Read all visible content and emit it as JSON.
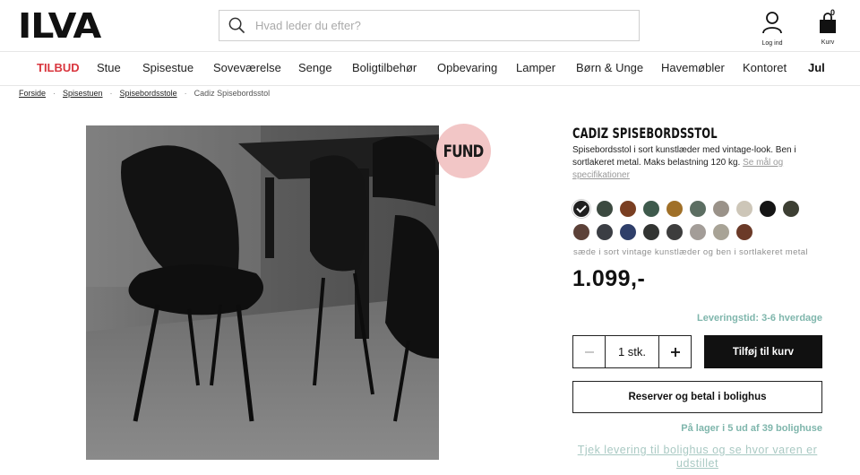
{
  "brand": {
    "logo_text": "ILVA"
  },
  "search": {
    "placeholder": "Hvad leder du efter?",
    "icon": "search-icon"
  },
  "account": {
    "label": "Log ind",
    "icon": "user-icon"
  },
  "cart": {
    "label": "Kurv",
    "count": "0",
    "icon": "bag-icon"
  },
  "nav": {
    "items": [
      {
        "label": "TILBUD",
        "style": "sale"
      },
      {
        "label": "Stue"
      },
      {
        "label": "Spisestue"
      },
      {
        "label": "Soveværelse"
      },
      {
        "label": "Senge"
      },
      {
        "label": "Boligtilbehør"
      },
      {
        "label": "Opbevaring"
      },
      {
        "label": "Lamper"
      },
      {
        "label": "Børn & Unge"
      },
      {
        "label": "Havemøbler"
      },
      {
        "label": "Kontoret"
      },
      {
        "label": "Jul",
        "style": "bold"
      }
    ]
  },
  "breadcrumb": {
    "items": [
      "Forside",
      "Spisestuen",
      "Spisebordsstole"
    ],
    "current": "Cadiz Spisebordsstol"
  },
  "badge": {
    "text": "FUND",
    "color": "#f2c6c6"
  },
  "product": {
    "title": "CADIZ SPISEBORDSSTOL",
    "description": "Spisebordsstol i sort kunstlæder med vintage-look. Ben i sortlakeret metal. Maks belastning 120 kg.",
    "spec_link": "Se mål og specifikationer",
    "variant_label": "sæde i sort vintage kunstlæder og ben i sortlakeret metal",
    "price": "1.099,-",
    "delivery": "Leveringstid: 3-6 hverdage",
    "quantity": "1 stk.",
    "add_to_cart": "Tilføj til kurv",
    "reserve": "Reserver og betal i bolighus",
    "stock": "På lager i 5 ud af 39 bolighuse",
    "check_link": "Tjek levering til bolighus og se hvor varen er udstillet"
  },
  "swatches": [
    {
      "color": "#1f1f1f",
      "selected": true
    },
    {
      "color": "#3c4a40"
    },
    {
      "color": "#7a3f22"
    },
    {
      "color": "#3e5a4c"
    },
    {
      "color": "#a07028"
    },
    {
      "color": "#5c6e62"
    },
    {
      "color": "#9a9289"
    },
    {
      "color": "#cdc6b8"
    },
    {
      "color": "#151515"
    },
    {
      "color": "#3d3f33"
    },
    {
      "color": "#5c4138"
    },
    {
      "color": "#3b3e44"
    },
    {
      "color": "#2f3f6a"
    },
    {
      "color": "#323432"
    },
    {
      "color": "#3d3d3d"
    },
    {
      "color": "#a39d98"
    },
    {
      "color": "#a8a396"
    },
    {
      "color": "#6b3a28"
    }
  ],
  "accent_colors": {
    "sale": "#d9363e",
    "info": "#7fb6ac"
  }
}
